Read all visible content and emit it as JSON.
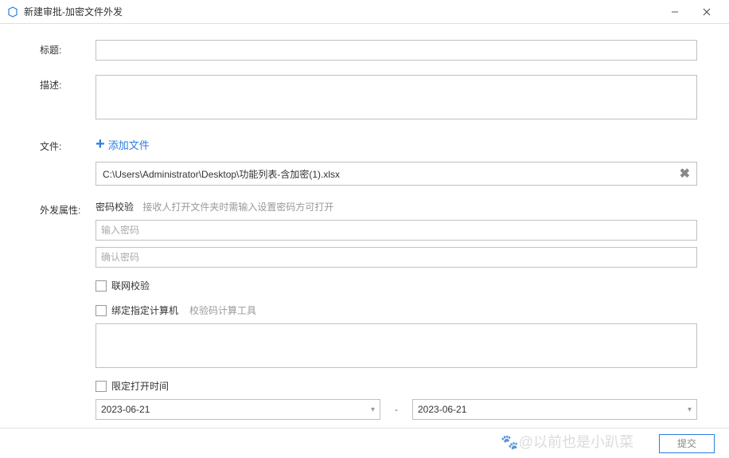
{
  "window": {
    "title": "新建审批-加密文件外发"
  },
  "labels": {
    "title": "标题:",
    "desc": "描述:",
    "file": "文件:",
    "attrs": "外发属性:"
  },
  "addFile": "添加文件",
  "filePath": "C:\\Users\\Administrator\\Desktop\\功能列表-含加密(1).xlsx",
  "pwd": {
    "label": "密码校验",
    "hint": "接收人打开文件夹时需输入设置密码方可打开",
    "placeholder1": "输入密码",
    "placeholder2": "确认密码"
  },
  "network": {
    "label": "联网校验"
  },
  "bindComputer": {
    "label": "绑定指定计算机",
    "tool": "校验码计算工具"
  },
  "limitTime": {
    "label": "限定打开时间"
  },
  "dateFrom": "2023-06-21",
  "dateTo": "2023-06-21",
  "dateSep": "-",
  "footer": {
    "submit": "提交"
  },
  "watermark": "@以前也是小趴菜"
}
